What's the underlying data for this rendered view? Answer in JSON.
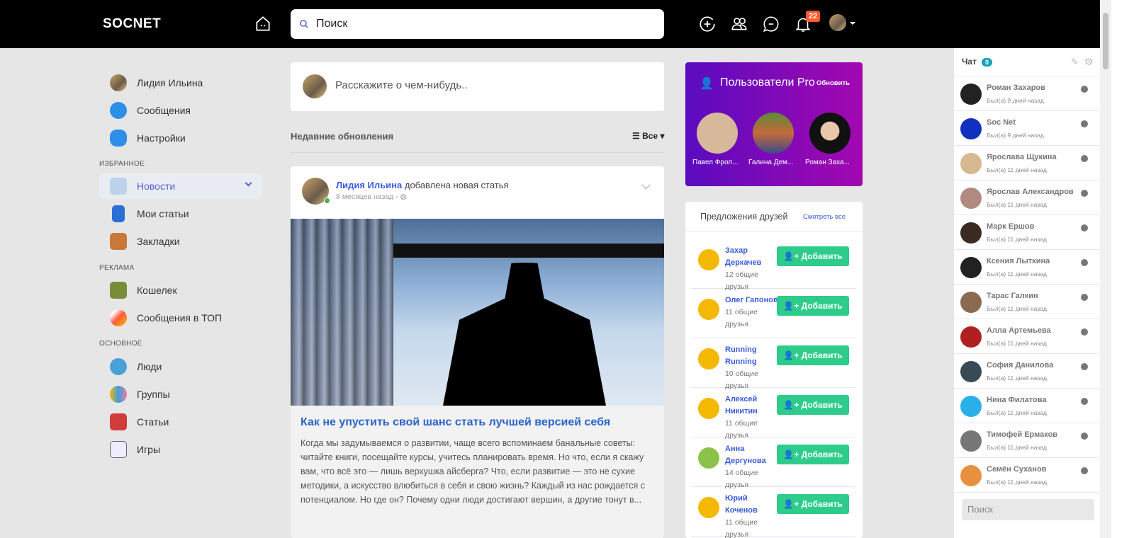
{
  "header": {
    "logo": "SOCNET",
    "search_placeholder": "Поиск",
    "notifications_count": "22"
  },
  "sidebar": {
    "profile": "Лидия Ильина",
    "top": [
      {
        "label": "Сообщения"
      },
      {
        "label": "Настройки"
      }
    ],
    "sections": [
      {
        "title": "ИЗБРАННОЕ",
        "items": [
          {
            "label": "Новости",
            "active": true
          },
          {
            "label": "Мои статьи"
          },
          {
            "label": "Закладки"
          }
        ]
      },
      {
        "title": "РЕКЛАМА",
        "items": [
          {
            "label": "Кошелек"
          },
          {
            "label": "Сообщения в ТОП"
          }
        ]
      },
      {
        "title": "ОСНОВНОЕ",
        "items": [
          {
            "label": "Люди"
          },
          {
            "label": "Группы"
          },
          {
            "label": "Статьи"
          },
          {
            "label": "Игры"
          }
        ]
      }
    ]
  },
  "composer": {
    "placeholder": "Расскажите о чем-нибудь.."
  },
  "feed": {
    "title": "Недавние обновления",
    "filter": "Все",
    "post": {
      "author": "Лидия Ильина",
      "action": "добавлена новая статья",
      "time": "8 месяцев назад",
      "sep": "-",
      "article_title": "Как не упустить свой шанс стать лучшей версией себя",
      "article_text": "Когда мы задумываемся о развитии, чаще всего вспоминаем банальные советы: читайте книги, посещайте курсы, учитесь планировать время. Но что, если я скажу вам, что всё это — лишь верхушка айсберга? Что, если развитие — это не сухие методики, а искусство влюбиться в себя и свою жизнь? Каждый из нас рождается с потенциалом. Но где он? Почему одни люди достигают вершин, а другие тонут в..."
    }
  },
  "pro": {
    "title": "Пользователи Pro",
    "refresh": "Обновить",
    "users": [
      "Павел Фрол...",
      "Галина Дем...",
      "Роман Заха..."
    ]
  },
  "suggestions": {
    "title": "Предложения друзей",
    "see_all": "Смотреть все",
    "add_label": "Добавить",
    "items": [
      {
        "name": "Захар Деркачев",
        "mutual": "12 общие друзья"
      },
      {
        "name": "Олег Гапонов",
        "mutual": "11 общие друзья"
      },
      {
        "name": "Running Running",
        "mutual": "10 общие друзья"
      },
      {
        "name": "Алексей Никитин",
        "mutual": "11 общие друзья"
      },
      {
        "name": "Анна Дергунова",
        "mutual": "14 общие друзья"
      },
      {
        "name": "Юрий Коченов",
        "mutual": "11 общие друзья"
      }
    ]
  },
  "chat": {
    "title": "Чат",
    "count": "0",
    "search_placeholder": "Поиск",
    "users": [
      {
        "name": "Роман Захаров",
        "status": "Был(а) 9 дней назад"
      },
      {
        "name": "Soc Net",
        "status": "Был(а) 9 дней назад"
      },
      {
        "name": "Ярослава Щукина",
        "status": "Был(а) 11 дней назад"
      },
      {
        "name": "Ярослав Александров",
        "status": "Был(а) 11 дней назад"
      },
      {
        "name": "Марк Ершов",
        "status": "Был(а) 11 дней назад"
      },
      {
        "name": "Ксения Лыткина",
        "status": "Был(а) 11 дней назад"
      },
      {
        "name": "Тарас Галкин",
        "status": "Был(а) 11 дней назад"
      },
      {
        "name": "Алла Артемьева",
        "status": "Был(а) 11 дней назад"
      },
      {
        "name": "София Данилова",
        "status": "Был(а) 11 дней назад"
      },
      {
        "name": "Нина Филатова",
        "status": "Был(а) 11 дней назад"
      },
      {
        "name": "Тимофей Ермаков",
        "status": "Был(а) 11 дней назад"
      },
      {
        "name": "Семён Суханов",
        "status": "Был(а) 11 дней назад"
      }
    ]
  }
}
